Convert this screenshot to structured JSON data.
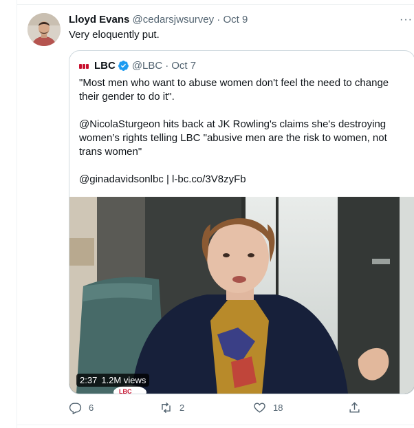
{
  "tweet": {
    "author_name": "Lloyd Evans",
    "author_handle": "@cedarsjwsurvey",
    "separator": "·",
    "date": "Oct 9",
    "more_label": "···",
    "text": "Very eloquently put."
  },
  "quote": {
    "logo_text": "LBC",
    "author_name": "LBC",
    "author_handle": "@LBC",
    "separator": "·",
    "date": "Oct 7",
    "paragraphs": [
      "\"Most men who want to abuse women don't feel the need to change their gender to do it\".",
      "@NicolaSturgeon hits back at JK Rowling's claims she's destroying women’s rights telling LBC \"abusive men are the risk to women, not trans women\"",
      "@ginadavidsonlbc | l-bc.co/3V8zyFb"
    ],
    "media": {
      "duration": "2:37",
      "views": "1.2M views",
      "mic_label": "LBC"
    }
  },
  "actions": {
    "reply_count": "6",
    "retweet_count": "2",
    "like_count": "18",
    "share_count": ""
  },
  "colors": {
    "verified": "#1d9bf0",
    "lbc_red": "#c8102e",
    "secondary_text": "#536471",
    "border": "#cfd9de"
  }
}
